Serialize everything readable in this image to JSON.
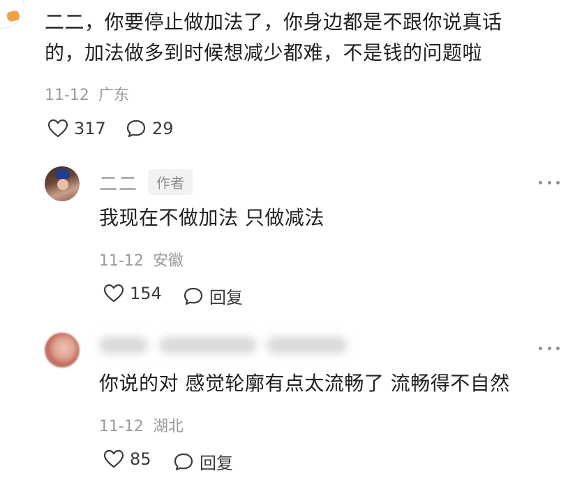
{
  "top_comment": {
    "text_line1": "二二，你要停止做加法了，你身边都是不跟你说真话",
    "text_line2": "的，加法做多到时候想减少都难，不是钱的问题啦",
    "date": "11-12",
    "location": "广东",
    "likes": "317",
    "replies": "29"
  },
  "reply_1": {
    "username": "二二",
    "badge": "作者",
    "text": "我现在不做加法 只做减法",
    "date": "11-12",
    "location": "安徽",
    "likes": "154",
    "reply_label": "回复"
  },
  "reply_2": {
    "text": "你说的对 感觉轮廓有点太流畅了 流畅得不自然",
    "date": "11-12",
    "location": "湖北",
    "likes": "85",
    "reply_label": "回复"
  },
  "icons": {
    "like": "heart-outline-icon",
    "comment": "speech-bubble-icon",
    "more": "more-dots-icon"
  },
  "colors": {
    "text": "#1f1f1f",
    "meta": "#9a9a9a",
    "username": "#8c8c8c",
    "badge_bg": "#f2f2f2"
  }
}
